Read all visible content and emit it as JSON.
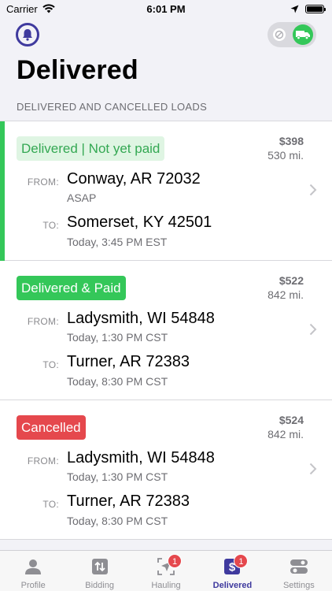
{
  "status_bar": {
    "carrier": "Carrier",
    "time": "6:01 PM"
  },
  "header": {
    "title": "Delivered",
    "section": "DELIVERED AND CANCELLED LOADS"
  },
  "colors": {
    "accent": "#3f3a9e",
    "green": "#34c759",
    "red": "#e5484d"
  },
  "loads": [
    {
      "status": "Delivered | Not yet paid",
      "price": "$398",
      "miles": "530 mi.",
      "from_label": "FROM:",
      "from_city": "Conway, AR 72032",
      "from_time": "ASAP",
      "to_label": "TO:",
      "to_city": "Somerset, KY 42501",
      "to_time": "Today, 3:45 PM EST"
    },
    {
      "status": "Delivered & Paid",
      "price": "$522",
      "miles": "842 mi.",
      "from_label": "FROM:",
      "from_city": "Ladysmith, WI 54848",
      "from_time": "Today, 1:30 PM CST",
      "to_label": "TO:",
      "to_city": "Turner, AR 72383",
      "to_time": "Today, 8:30 PM CST"
    },
    {
      "status": "Cancelled",
      "price": "$524",
      "miles": "842 mi.",
      "from_label": "FROM:",
      "from_city": "Ladysmith, WI 54848",
      "from_time": "Today, 1:30 PM CST",
      "to_label": "TO:",
      "to_city": "Turner, AR 72383",
      "to_time": "Today, 8:30 PM CST"
    }
  ],
  "tabs": [
    {
      "label": "Profile",
      "icon": "person-icon"
    },
    {
      "label": "Bidding",
      "icon": "arrows-icon"
    },
    {
      "label": "Hauling",
      "icon": "navigation-icon",
      "badge": "1"
    },
    {
      "label": "Delivered",
      "icon": "dollar-icon",
      "badge": "1"
    },
    {
      "label": "Settings",
      "icon": "toggles-icon"
    }
  ]
}
